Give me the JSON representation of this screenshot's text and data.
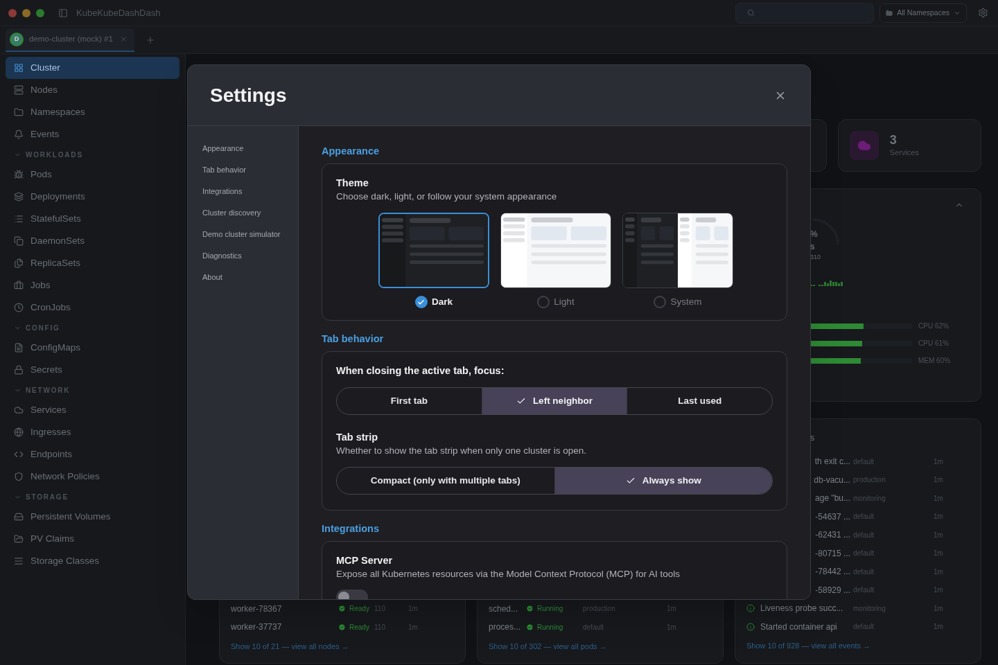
{
  "window": {
    "title": "KubeKubeDashDash"
  },
  "toolbar": {
    "namespace_selector": "All Namespaces"
  },
  "tabs": [
    {
      "avatar": "D",
      "label": "demo-cluster (mock) #1",
      "selected": true
    }
  ],
  "sidebar": {
    "items": [
      {
        "label": "Cluster",
        "selected": true
      },
      {
        "label": "Nodes",
        "selected": false
      },
      {
        "label": "Namespaces",
        "selected": false
      },
      {
        "label": "Events",
        "selected": false
      }
    ],
    "sections": [
      {
        "label": "WORKLOADS",
        "expanded": true,
        "items": [
          {
            "label": "Pods",
            "selected": false
          },
          {
            "label": "Deployments",
            "selected": false
          },
          {
            "label": "StatefulSets",
            "selected": false
          },
          {
            "label": "DaemonSets",
            "selected": false
          },
          {
            "label": "ReplicaSets",
            "selected": false
          },
          {
            "label": "Jobs",
            "selected": false
          },
          {
            "label": "CronJobs",
            "selected": false
          }
        ]
      },
      {
        "label": "CONFIG",
        "expanded": true,
        "items": [
          {
            "label": "ConfigMaps",
            "selected": false
          },
          {
            "label": "Secrets",
            "selected": false
          }
        ]
      },
      {
        "label": "NETWORK",
        "expanded": true,
        "items": [
          {
            "label": "Services",
            "selected": false
          },
          {
            "label": "Ingresses",
            "selected": false
          },
          {
            "label": "Endpoints",
            "selected": false
          },
          {
            "label": "Network Policies",
            "selected": false
          }
        ]
      },
      {
        "label": "STORAGE",
        "expanded": true,
        "items": [
          {
            "label": "Persistent Volumes",
            "selected": false
          },
          {
            "label": "PV Claims",
            "selected": false
          },
          {
            "label": "Storage Classes",
            "selected": false
          }
        ]
      }
    ]
  },
  "dashboard": {
    "stat_card": {
      "value": "3",
      "label": "Services"
    },
    "resource_usage": {
      "gauge_fragments": [
        "%",
        "s",
        "310"
      ],
      "bars": [
        {
          "label": "CPU 62%",
          "level": 0.62
        },
        {
          "label": "CPU 61%",
          "level": 0.61
        },
        {
          "label": "MEM 60%",
          "level": 0.6
        }
      ]
    },
    "nodes_card": {
      "rows": [
        {
          "name": "worker-78367",
          "status": "Ready",
          "column_3": "110",
          "age": "1m"
        },
        {
          "name": "worker-37737",
          "status": "Ready",
          "column_3": "110",
          "age": "1m"
        }
      ],
      "link": "Show 10 of 21 — view all nodes →"
    },
    "pods_card": {
      "rows": [
        {
          "name": "sched...",
          "status": "Running",
          "namespace": "production",
          "age": "1m"
        },
        {
          "name": "proces...",
          "status": "Running",
          "namespace": "default",
          "age": "1m"
        }
      ],
      "link": "Show 10 of 302 — view all pods →"
    },
    "events_card": {
      "title_fragment": "s",
      "rows": [
        {
          "kind": "cut",
          "message": "th exit c...",
          "namespace": "default",
          "age": "1m"
        },
        {
          "kind": "cut",
          "message": "db-vacu...",
          "namespace": "production",
          "age": "1m"
        },
        {
          "kind": "cut",
          "message": "age \"bu...",
          "namespace": "monitoring",
          "age": "1m"
        },
        {
          "kind": "cut",
          "message": "-54637 ...",
          "namespace": "default",
          "age": "1m"
        },
        {
          "kind": "cut",
          "message": "-62431 ...",
          "namespace": "default",
          "age": "1m"
        },
        {
          "kind": "cut",
          "message": "-80715 ...",
          "namespace": "default",
          "age": "1m"
        },
        {
          "kind": "cut",
          "message": "-78442 ...",
          "namespace": "default",
          "age": "1m"
        },
        {
          "kind": "cut",
          "message": "-58929 ...",
          "namespace": "default",
          "age": "1m"
        },
        {
          "kind": "info",
          "message": "Liveness probe succ...",
          "namespace": "monitoring",
          "age": "1m"
        },
        {
          "kind": "info",
          "message": "Started container api",
          "namespace": "default",
          "age": "1m"
        }
      ],
      "link": "Show 10 of 928 — view all events →"
    }
  },
  "settings": {
    "title": "Settings",
    "nav": [
      {
        "label": "Appearance"
      },
      {
        "label": "Tab behavior"
      },
      {
        "label": "Integrations"
      },
      {
        "label": "Cluster discovery"
      },
      {
        "label": "Demo cluster simulator"
      },
      {
        "label": "Diagnostics"
      },
      {
        "label": "About"
      }
    ],
    "appearance": {
      "heading": "Appearance",
      "theme": {
        "title": "Theme",
        "description": "Choose dark, light, or follow your system appearance",
        "options": [
          {
            "kind": "dark",
            "label": "Dark",
            "selected": true
          },
          {
            "kind": "light",
            "label": "Light",
            "selected": false
          },
          {
            "kind": "system",
            "label": "System",
            "selected": false
          }
        ]
      }
    },
    "tab_behavior": {
      "heading": "Tab behavior",
      "close_focus": {
        "title": "When closing the active tab, focus:",
        "options": [
          {
            "label": "First tab",
            "selected": false
          },
          {
            "label": "Left neighbor",
            "selected": true
          },
          {
            "label": "Last used",
            "selected": false
          }
        ]
      },
      "tab_strip": {
        "title": "Tab strip",
        "description": "Whether to show the tab strip when only one cluster is open.",
        "options": [
          {
            "label": "Compact (only with multiple tabs)",
            "selected": false
          },
          {
            "label": "Always show",
            "selected": true
          }
        ]
      }
    },
    "integrations": {
      "heading": "Integrations",
      "mcp_server": {
        "title": "MCP Server",
        "description": "Expose all Kubernetes resources via the Model Context Protocol (MCP) for AI tools",
        "on": false
      }
    }
  }
}
